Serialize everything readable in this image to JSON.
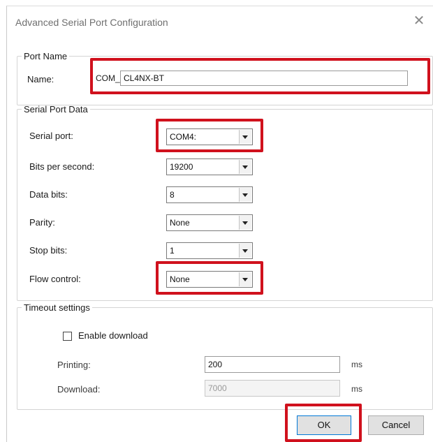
{
  "window": {
    "title": "Advanced Serial Port Configuration",
    "close_glyph": "✕"
  },
  "port_name": {
    "legend": "Port Name",
    "name_label": "Name:",
    "prefix": "COM_",
    "value": "CL4NX-BT"
  },
  "serial_port_data": {
    "legend": "Serial Port Data",
    "fields": [
      {
        "label": "Serial port:",
        "value": "COM4:"
      },
      {
        "label": "Bits per second:",
        "value": "19200"
      },
      {
        "label": "Data bits:",
        "value": "8"
      },
      {
        "label": "Parity:",
        "value": "None"
      },
      {
        "label": "Stop bits:",
        "value": "1"
      },
      {
        "label": "Flow control:",
        "value": "None"
      }
    ]
  },
  "timeout_settings": {
    "legend": "Timeout settings",
    "enable_download_label": "Enable download",
    "enable_download_checked": false,
    "printing_label": "Printing:",
    "printing_value": "200",
    "printing_unit": "ms",
    "download_label": "Download:",
    "download_value": "7000",
    "download_unit": "ms"
  },
  "buttons": {
    "ok": "OK",
    "cancel": "Cancel"
  },
  "colors": {
    "highlight": "#d0111d",
    "default_button_border": "#0078d7"
  },
  "icons": {
    "close": "close-icon",
    "dropdown": "chevron-down-icon"
  }
}
